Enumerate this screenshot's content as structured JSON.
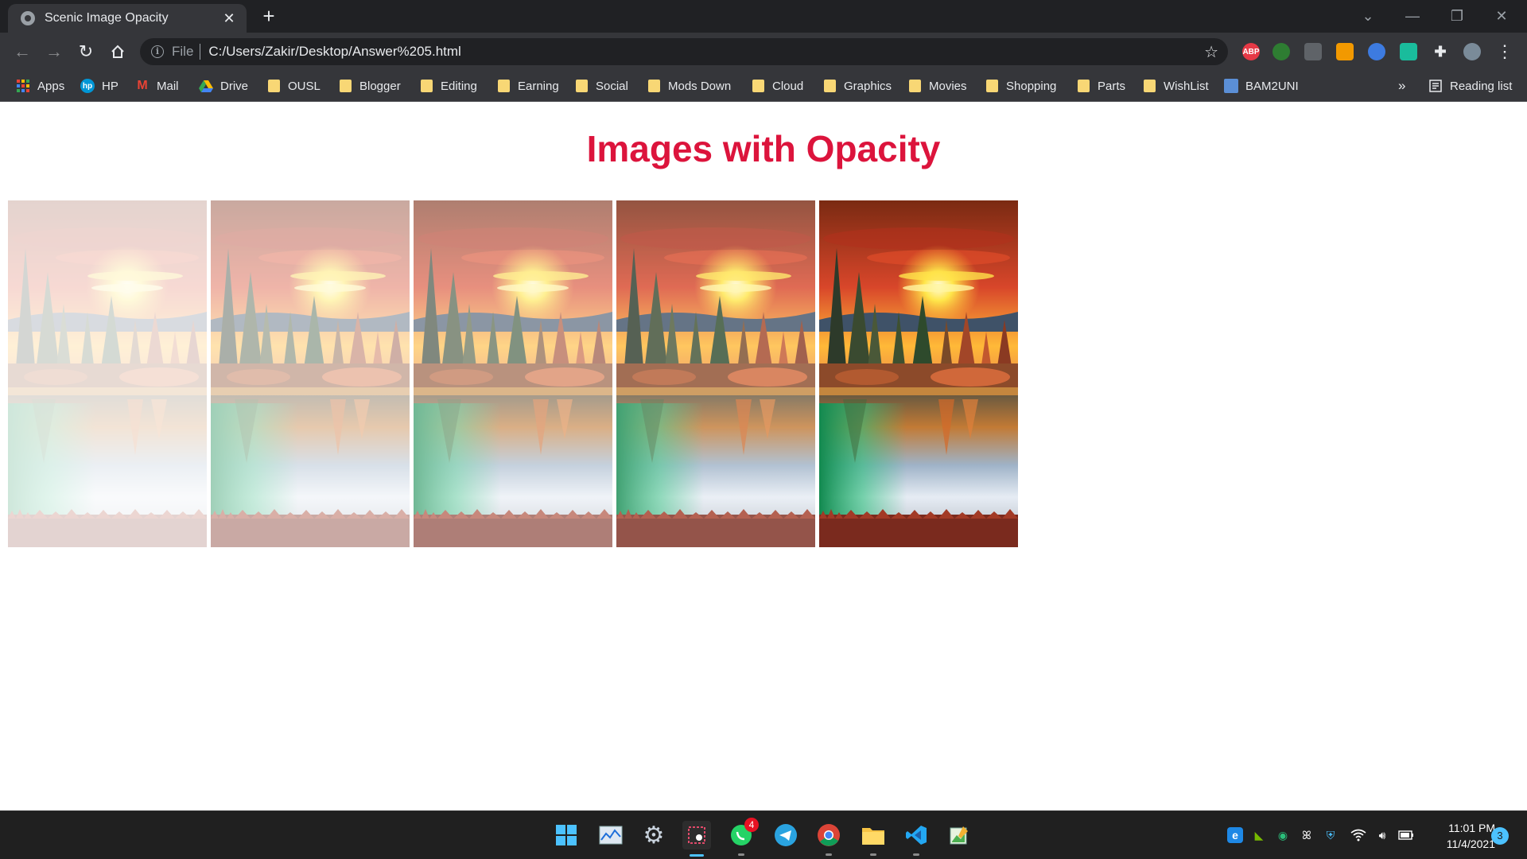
{
  "browser": {
    "tab_title": "Scenic Image Opacity",
    "new_tab_symbol": "+",
    "address_scheme": "File",
    "address_url": "C:/Users/Zakir/Desktop/Answer%205.html",
    "extensions": [
      "ABP",
      "camera-extension",
      "pdf-extension",
      "mail-extension",
      "eyes-extension",
      "stripes-extension",
      "puzzle-icon",
      "profile-avatar"
    ],
    "bookmarks": [
      {
        "label": "Apps",
        "icon": "apps-grid-icon"
      },
      {
        "label": "HP",
        "icon": "hp-logo-icon"
      },
      {
        "label": "Mail",
        "icon": "gmail-icon"
      },
      {
        "label": "Drive",
        "icon": "drive-icon"
      },
      {
        "label": "OUSL",
        "icon": "folder-icon"
      },
      {
        "label": "Blogger",
        "icon": "folder-icon"
      },
      {
        "label": "Editing",
        "icon": "folder-icon"
      },
      {
        "label": "Earning",
        "icon": "folder-icon"
      },
      {
        "label": "Social",
        "icon": "folder-icon"
      },
      {
        "label": "Mods Down",
        "icon": "folder-icon"
      },
      {
        "label": "Cloud",
        "icon": "folder-icon"
      },
      {
        "label": "Graphics",
        "icon": "folder-icon"
      },
      {
        "label": "Movies",
        "icon": "folder-icon"
      },
      {
        "label": "Shopping",
        "icon": "folder-icon"
      },
      {
        "label": "Parts",
        "icon": "folder-icon"
      },
      {
        "label": "WishList",
        "icon": "folder-icon"
      },
      {
        "label": "BAM2UNI",
        "icon": "site-icon"
      }
    ],
    "overflow_label": "»",
    "reading_list": "Reading list"
  },
  "page": {
    "heading": "Images with Opacity",
    "heading_color": "#dc143c",
    "images": [
      {
        "opacity": 0.2
      },
      {
        "opacity": 0.4
      },
      {
        "opacity": 0.6
      },
      {
        "opacity": 0.8
      },
      {
        "opacity": 1.0
      }
    ]
  },
  "taskbar": {
    "whatsapp_badge": "4",
    "time": "11:01 PM",
    "date": "11/4/2021",
    "notifications": "3"
  }
}
